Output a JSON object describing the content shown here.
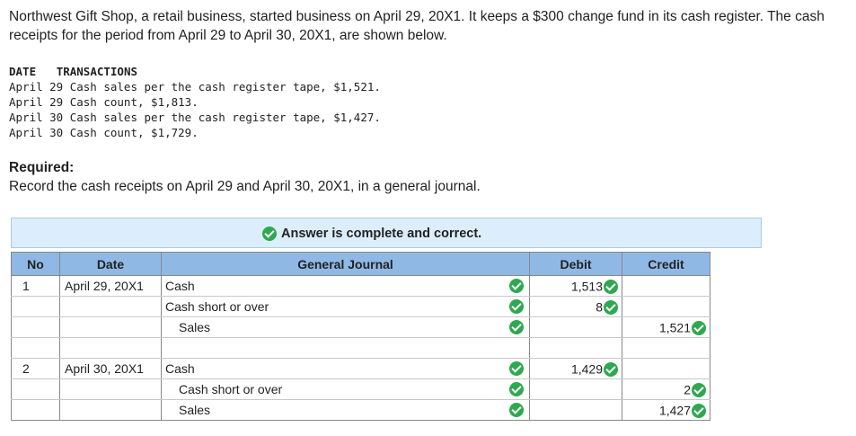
{
  "intro": "Northwest Gift Shop, a retail business, started business on April 29, 20X1. It keeps a $300 change fund in its cash register. The cash receipts for the period from April 29 to April 30, 20X1, are shown below.",
  "transactions": {
    "header_date": "DATE",
    "header_trans": "TRANSACTIONS",
    "lines": [
      "April 29 Cash sales per the cash register tape, $1,521.",
      "April 29 Cash count, $1,813.",
      "April 30 Cash sales per the cash register tape, $1,427.",
      "April 30 Cash count, $1,729."
    ]
  },
  "required": {
    "label": "Required:",
    "text": "Record the cash receipts on April 29 and April 30, 20X1, in a general journal."
  },
  "banner": {
    "text": "Answer is complete and correct."
  },
  "journal": {
    "headers": {
      "no": "No",
      "date": "Date",
      "general_journal": "General Journal",
      "debit": "Debit",
      "credit": "Credit"
    },
    "rows": [
      {
        "no": "1",
        "date": "April 29, 20X1",
        "account": "Cash",
        "debit": "1,513",
        "credit": ""
      },
      {
        "no": "",
        "date": "",
        "account": "Cash short or over",
        "debit": "8",
        "credit": ""
      },
      {
        "no": "",
        "date": "",
        "account": "Sales",
        "debit": "",
        "credit": "1,521"
      },
      {
        "no": "",
        "date": "",
        "account": "",
        "debit": "",
        "credit": ""
      },
      {
        "no": "2",
        "date": "April 30, 20X1",
        "account": "Cash",
        "debit": "1,429",
        "credit": ""
      },
      {
        "no": "",
        "date": "",
        "account": "Cash short or over",
        "debit": "",
        "credit": "2"
      },
      {
        "no": "",
        "date": "",
        "account": "Sales",
        "debit": "",
        "credit": "1,427"
      }
    ]
  }
}
